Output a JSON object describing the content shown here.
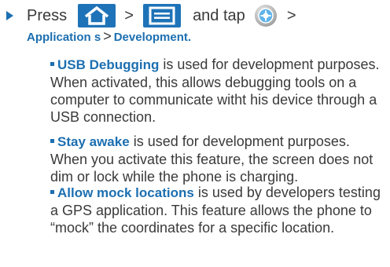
{
  "step": {
    "press_text": "Press",
    "separator": ">",
    "and_tap_text": "and tap",
    "icons": [
      "home-key-icon",
      "menu-key-icon",
      "settings-gear-icon"
    ],
    "path": {
      "part1": "Application s",
      "separator": ">",
      "part2": "Development."
    }
  },
  "bullets": [
    {
      "term": "USB Debugging",
      "text": " is used for development purposes. When activated, this allows debugging tools on a computer to communicate witht his device through a USB connection."
    },
    {
      "term": "Stay awake",
      "text": " is used for development purposes. When you activate this feature, the screen does not dim or lock while the phone is charging."
    },
    {
      "term": "Allow mock locations",
      "text": " is used by developers testing a GPS application. This feature allows the phone to “mock” the coordinates for a specific location."
    }
  ],
  "colors": {
    "accent": "#1c6fb1",
    "key_background": "#1e73b8",
    "body_text": "#3a3a3a"
  }
}
